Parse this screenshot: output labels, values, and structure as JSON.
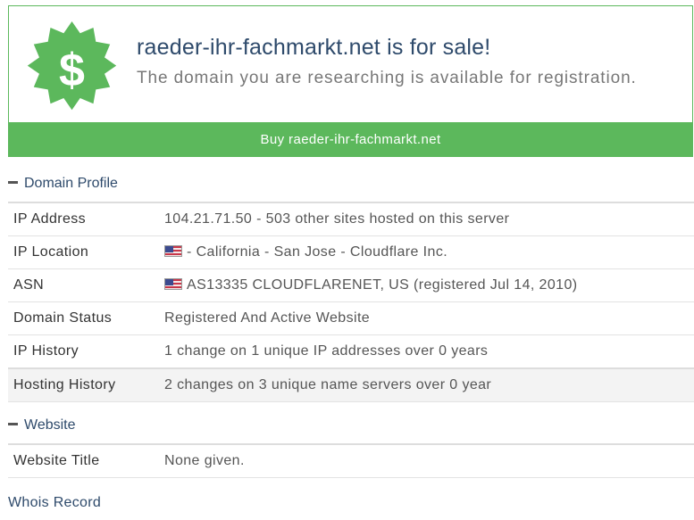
{
  "banner": {
    "title": "raeder-ihr-fachmarkt.net is for sale!",
    "subtitle": "The domain you are researching is available for registration.",
    "buy_label": "Buy raeder-ihr-fachmarkt.net",
    "badge_icon": "dollar-badge-icon",
    "accent_color": "#5cb85c"
  },
  "domain_profile": {
    "heading": "Domain Profile",
    "rows": [
      {
        "label": "IP Address",
        "value": "104.21.71.50 - 503 other sites hosted on this server"
      },
      {
        "label": "IP Location",
        "value": "- California - San Jose - Cloudflare Inc.",
        "icon": "us-flag-icon"
      },
      {
        "label": "ASN",
        "value": "AS13335 CLOUDFLARENET, US (registered Jul 14, 2010)",
        "icon": "us-flag-icon"
      },
      {
        "label": "Domain Status",
        "value": "Registered And Active Website"
      },
      {
        "label": "IP History",
        "value": "1 change on 1 unique IP addresses over 0 years"
      },
      {
        "label": "Hosting History",
        "value": "2 changes on 3 unique name servers over 0 year"
      }
    ]
  },
  "website": {
    "heading": "Website",
    "rows": [
      {
        "label": "Website Title",
        "value": "None given."
      }
    ]
  },
  "whois": {
    "heading": "Whois Record"
  }
}
